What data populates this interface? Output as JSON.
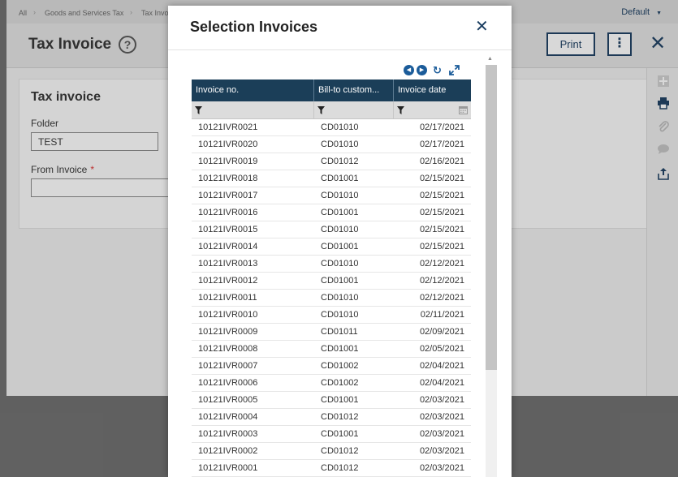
{
  "breadcrumb": {
    "items": [
      "All",
      "Goods and Services Tax",
      "Tax Invo"
    ]
  },
  "user_menu": {
    "label": "Default"
  },
  "page": {
    "title": "Tax Invoice",
    "help": "?",
    "print_label": "Print",
    "more_label": "⋮",
    "close_label": "✕"
  },
  "form": {
    "title": "Tax invoice",
    "folder_label": "Folder",
    "folder_value": "TEST",
    "from_invoice_label": "From Invoice",
    "required_mark": "*"
  },
  "rail": {
    "icons": [
      "plus-icon",
      "printer-icon",
      "paperclip-icon",
      "comment-icon",
      "share-icon"
    ]
  },
  "modal": {
    "title": "Selection Invoices",
    "close_label": "✕",
    "columns": [
      "Invoice no.",
      "Bill-to custom...",
      "Invoice date"
    ],
    "rows": [
      [
        "10121IVR0021",
        "CD01010",
        "02/17/2021"
      ],
      [
        "10121IVR0020",
        "CD01010",
        "02/17/2021"
      ],
      [
        "10121IVR0019",
        "CD01012",
        "02/16/2021"
      ],
      [
        "10121IVR0018",
        "CD01001",
        "02/15/2021"
      ],
      [
        "10121IVR0017",
        "CD01010",
        "02/15/2021"
      ],
      [
        "10121IVR0016",
        "CD01001",
        "02/15/2021"
      ],
      [
        "10121IVR0015",
        "CD01010",
        "02/15/2021"
      ],
      [
        "10121IVR0014",
        "CD01001",
        "02/15/2021"
      ],
      [
        "10121IVR0013",
        "CD01010",
        "02/12/2021"
      ],
      [
        "10121IVR0012",
        "CD01001",
        "02/12/2021"
      ],
      [
        "10121IVR0011",
        "CD01010",
        "02/12/2021"
      ],
      [
        "10121IVR0010",
        "CD01010",
        "02/11/2021"
      ],
      [
        "10121IVR0009",
        "CD01011",
        "02/09/2021"
      ],
      [
        "10121IVR0008",
        "CD01001",
        "02/05/2021"
      ],
      [
        "10121IVR0007",
        "CD01002",
        "02/04/2021"
      ],
      [
        "10121IVR0006",
        "CD01002",
        "02/04/2021"
      ],
      [
        "10121IVR0005",
        "CD01001",
        "02/03/2021"
      ],
      [
        "10121IVR0004",
        "CD01012",
        "02/03/2021"
      ],
      [
        "10121IVR0003",
        "CD01001",
        "02/03/2021"
      ],
      [
        "10121IVR0002",
        "CD01012",
        "02/03/2021"
      ],
      [
        "10121IVR0001",
        "CD01012",
        "02/03/2021"
      ]
    ]
  },
  "colors": {
    "accent": "#1b3e61",
    "grid_header": "#1b3e58",
    "icon_blue": "#1b5c9a",
    "required": "#dd3333"
  }
}
